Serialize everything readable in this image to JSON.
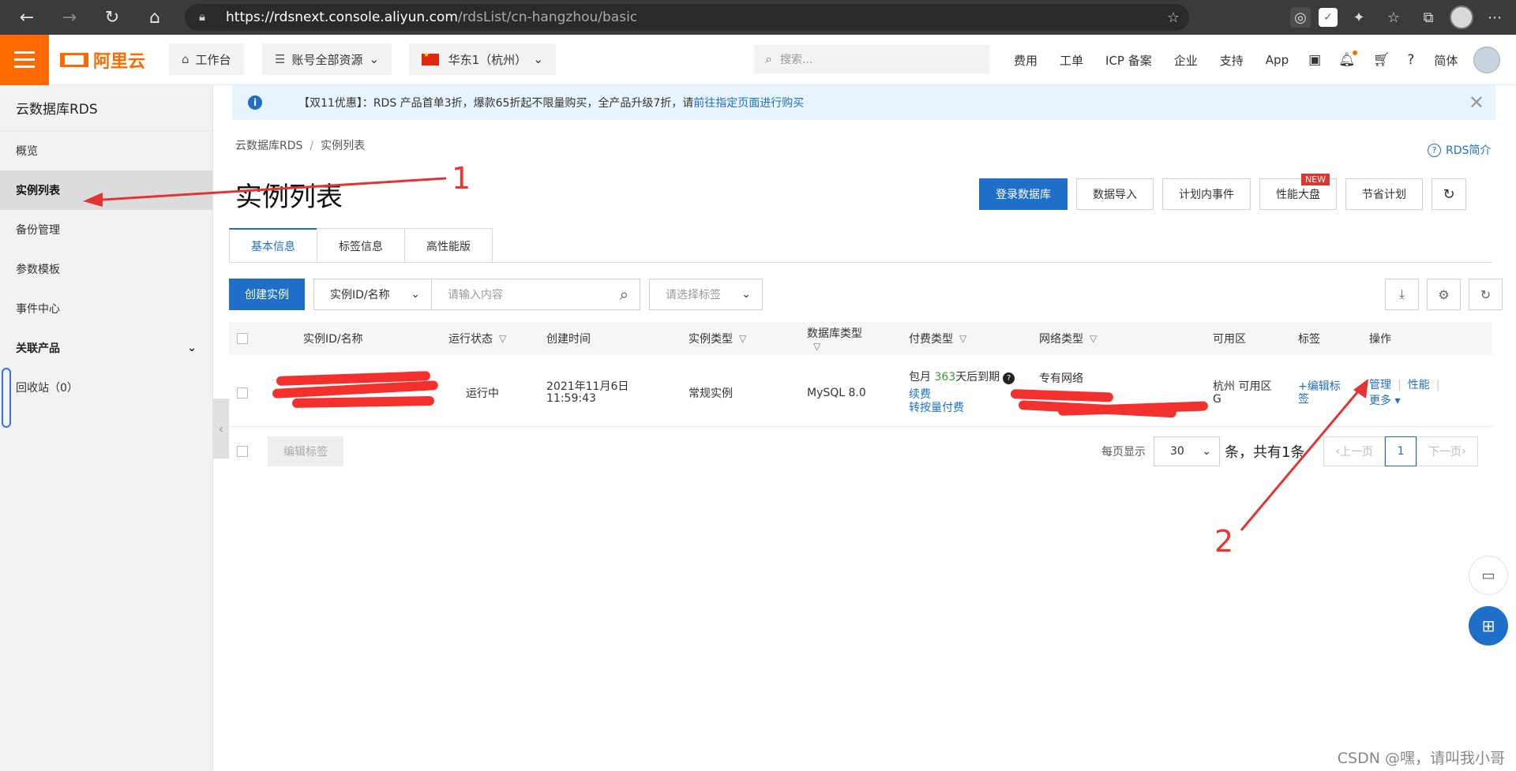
{
  "browser": {
    "url_host": "https://rdsnext.console.aliyun.com",
    "url_path": "/rdsList/cn-hangzhou/basic"
  },
  "topnav": {
    "logo_text": "阿里云",
    "workbench": "工作台",
    "resources": "账号全部资源",
    "region": "华东1（杭州）",
    "search_placeholder": "搜索...",
    "links": [
      "费用",
      "工单",
      "ICP 备案",
      "企业",
      "支持",
      "App"
    ],
    "lang": "简体"
  },
  "sidebar": {
    "title": "云数据库RDS",
    "items": [
      {
        "label": "概览"
      },
      {
        "label": "实例列表"
      },
      {
        "label": "备份管理"
      },
      {
        "label": "参数模板"
      },
      {
        "label": "事件中心"
      }
    ],
    "group": "关联产品",
    "recycle": "回收站（0）"
  },
  "banner": {
    "text": "【双11优惠】：RDS 产品首单3折，爆款65折起不限量购买，全产品升级7折，请",
    "link": "前往指定页面进行购买"
  },
  "breadcrumb": [
    "云数据库RDS",
    "实例列表"
  ],
  "rds_help": "RDS简介",
  "page_title": "实例列表",
  "actions": {
    "login_db": "登录数据库",
    "data_import": "数据导入",
    "planned_events": "计划内事件",
    "perf_dashboard": "性能大盘",
    "new_badge": "NEW",
    "savings_plan": "节省计划"
  },
  "tabs": [
    "基本信息",
    "标签信息",
    "高性能版"
  ],
  "toolbar": {
    "create": "创建实例",
    "filter_field": "实例ID/名称",
    "input_placeholder": "请输入内容",
    "tag_placeholder": "请选择标签"
  },
  "table": {
    "headers": [
      "实例ID/名称",
      "运行状态",
      "创建时间",
      "实例类型",
      "数据库类型",
      "付费类型",
      "网络类型",
      "可用区",
      "标签",
      "操作"
    ],
    "row": {
      "status": "运行中",
      "created_date": "2021年11月6日",
      "created_time": "11:59:43",
      "instance_type": "常规实例",
      "db_type": "MySQL 8.0",
      "pay_prefix": "包月",
      "pay_days": "363",
      "pay_suffix": "天后到期",
      "renew": "续费",
      "to_postpaid": "转按量付费",
      "network": "专有网络",
      "zone": "杭州 可用区G",
      "edit_tag": "+编辑标签",
      "op_manage": "管理",
      "op_perf": "性能",
      "op_more": "更多"
    }
  },
  "footer": {
    "edit_tag": "编辑标签",
    "per_page_label": "每页显示",
    "page_size": "30",
    "count": "条，共有1条",
    "prev": "上一页",
    "page": "1",
    "next": "下一页"
  },
  "annotations": {
    "one": "1",
    "two": "2"
  },
  "watermark": "CSDN @嘿，请叫我小哥",
  "colors": {
    "brand": "#ff6a00",
    "primary": "#1f6fc8",
    "annotation": "#e33333"
  }
}
